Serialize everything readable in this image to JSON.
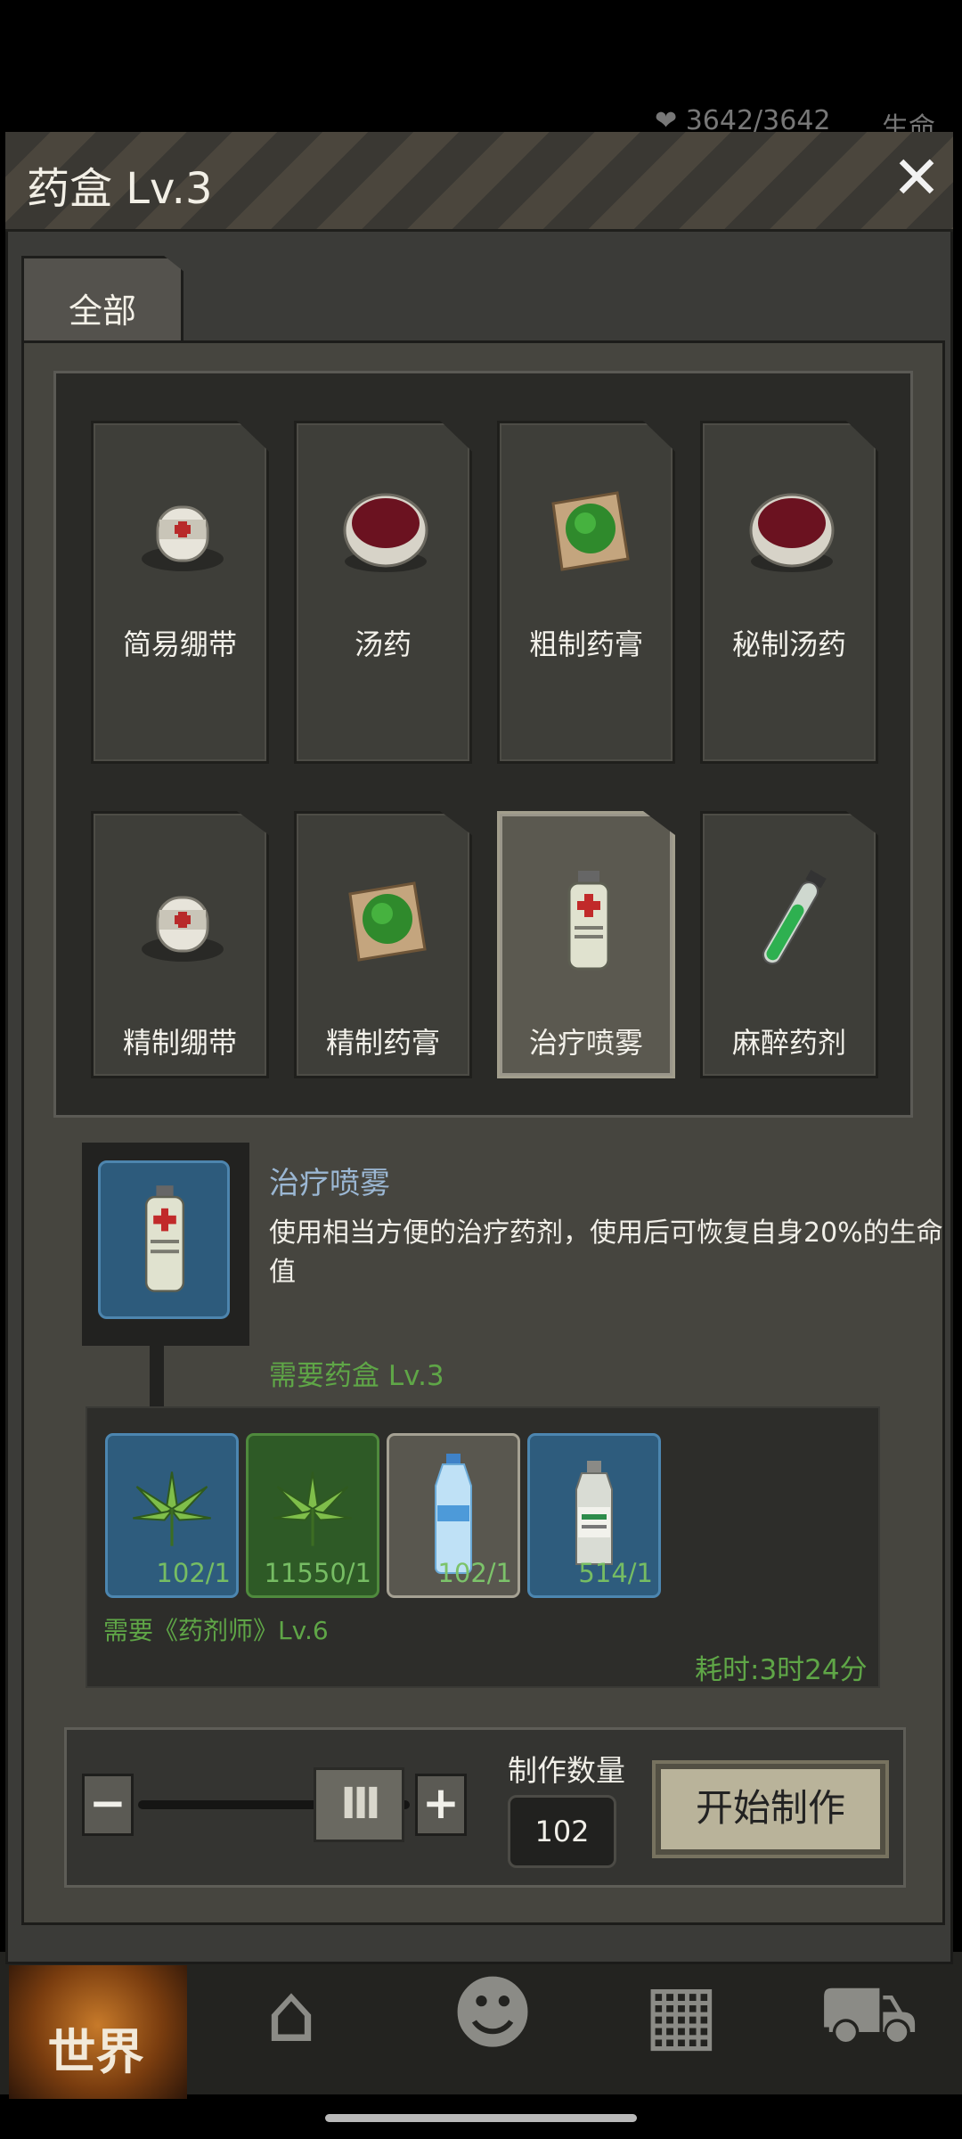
{
  "status": {
    "hp": "3642/3642",
    "life_label": "生命"
  },
  "panel": {
    "title": "药盒 Lv.3",
    "close_label": "✕"
  },
  "tabs": [
    {
      "label": "全部"
    }
  ],
  "recipes": [
    {
      "name": "简易绷带",
      "icon": "bandage-icon"
    },
    {
      "name": "汤药",
      "icon": "soup-bowl-icon"
    },
    {
      "name": "粗制药膏",
      "icon": "herb-ointment-icon"
    },
    {
      "name": "秘制汤药",
      "icon": "soup-bowl-icon"
    },
    {
      "name": "精制绷带",
      "icon": "bandage-icon"
    },
    {
      "name": "精制药膏",
      "icon": "herb-ointment-icon"
    },
    {
      "name": "治疗喷雾",
      "icon": "spray-can-icon",
      "selected": true
    },
    {
      "name": "麻醉药剂",
      "icon": "test-tube-icon"
    }
  ],
  "detail": {
    "name": "治疗喷雾",
    "description": "使用相当方便的治疗药剂，使用后可恢复自身20%的生命值",
    "required_level": "需要药盒 Lv.3",
    "required_skill": "需要《药剂师》Lv.6",
    "time_cost": "耗时:3时24分",
    "materials": [
      {
        "icon": "herb-leaf-icon",
        "count": "102/1",
        "style": "blue"
      },
      {
        "icon": "herb-leaf-icon",
        "count": "11550/1",
        "style": "green"
      },
      {
        "icon": "water-bottle-icon",
        "count": "102/1",
        "style": "gray"
      },
      {
        "icon": "alcohol-bottle-icon",
        "count": "514/1",
        "style": "blue"
      }
    ]
  },
  "craft": {
    "minus_label": "−",
    "plus_label": "+",
    "slider_handle": "III",
    "slider_fraction": 1,
    "quantity_label": "制作数量",
    "quantity": "102",
    "start_label": "开始制作"
  },
  "nav": {
    "world_label": "世界"
  },
  "colors": {
    "accent_green": "#5fa647",
    "selected_blue": "#2e5c7d",
    "panel_bg": "#3b3b38"
  }
}
